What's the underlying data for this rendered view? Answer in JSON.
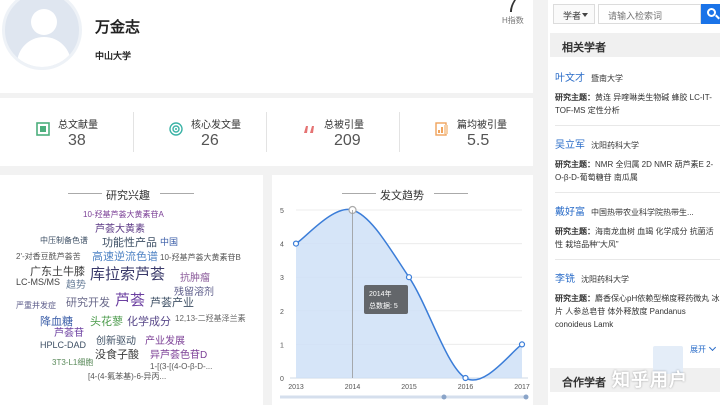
{
  "profile": {
    "name": "万金志",
    "affiliation": "中山大学",
    "hindex_value": "7",
    "hindex_label": "H指数"
  },
  "stats": [
    {
      "label": "总文献量",
      "value": "38",
      "icon": "document-icon",
      "color": "#4caf7d"
    },
    {
      "label": "核心发文量",
      "value": "26",
      "icon": "target-icon",
      "color": "#3bb3a6"
    },
    {
      "label": "总被引量",
      "value": "209",
      "icon": "quote-icon",
      "color": "#e57373"
    },
    {
      "label": "篇均被引量",
      "value": "5.5",
      "icon": "chart-doc-icon",
      "color": "#f0a35c"
    }
  ],
  "interest": {
    "title": "研究兴趣",
    "words": [
      {
        "text": "10-羟基芦荟大黄素苷A",
        "color": "#7b3f96",
        "size": 8
      },
      {
        "text": "芦荟大黄素",
        "color": "#5c3a86",
        "size": 10
      },
      {
        "text": "中压制备色谱",
        "color": "#3d4f64",
        "size": 8
      },
      {
        "text": "功能性产品",
        "color": "#3d4f64",
        "size": 11
      },
      {
        "text": "中国",
        "color": "#3b5ea8",
        "size": 9
      },
      {
        "text": "2'-对香豆酰芦荟苦",
        "color": "#555555",
        "size": 8
      },
      {
        "text": "高速逆流色谱",
        "color": "#4f83c4",
        "size": 11
      },
      {
        "text": "10-羟基芦荟大黄素苷B",
        "color": "#555555",
        "size": 8
      },
      {
        "text": "广东土牛膝",
        "color": "#3a3a3a",
        "size": 11
      },
      {
        "text": "库拉索芦荟",
        "color": "#3a3a6a",
        "size": 15
      },
      {
        "text": "抗肿瘤",
        "color": "#8a5a9a",
        "size": 10
      },
      {
        "text": "LC-MS/MS",
        "color": "#444444",
        "size": 9
      },
      {
        "text": "趋势",
        "color": "#6a7f9a",
        "size": 10
      },
      {
        "text": "残留溶剂",
        "color": "#5c5c8a",
        "size": 10
      },
      {
        "text": "严重并发症",
        "color": "#5c5c8a",
        "size": 8
      },
      {
        "text": "研究开发",
        "color": "#6a6a8a",
        "size": 11
      },
      {
        "text": "芦荟",
        "color": "#6b3fa0",
        "size": 15
      },
      {
        "text": "芦荟产业",
        "color": "#3d4f64",
        "size": 11
      },
      {
        "text": "降血糖",
        "color": "#3b5ea8",
        "size": 11
      },
      {
        "text": "头花蓼",
        "color": "#4a9a4a",
        "size": 11
      },
      {
        "text": "化学成分",
        "color": "#5a4a8a",
        "size": 11
      },
      {
        "text": "12,13-二羟基泽兰素",
        "color": "#666666",
        "size": 8
      },
      {
        "text": "芦荟苷",
        "color": "#6b3fa0",
        "size": 10
      },
      {
        "text": "HPLC-DAD",
        "color": "#3d4f64",
        "size": 9
      },
      {
        "text": "创新驱动",
        "color": "#3d4f64",
        "size": 10
      },
      {
        "text": "产业发展",
        "color": "#7b3f96",
        "size": 10
      },
      {
        "text": "没食子酸",
        "color": "#3a3a3a",
        "size": 11
      },
      {
        "text": "异芦荟色苷D",
        "color": "#7b3f96",
        "size": 10
      },
      {
        "text": "3T3-L1细胞",
        "color": "#5a8a5a",
        "size": 8
      },
      {
        "text": "1-[(3-[(4-O-β-D-...",
        "color": "#555555",
        "size": 8
      },
      {
        "text": "[4-(4-氟苯基)-6-异丙...",
        "color": "#555555",
        "size": 8
      }
    ]
  },
  "trend": {
    "title": "发文趋势",
    "tooltip": {
      "year": "2014年",
      "label": "总数据",
      "value": "5"
    }
  },
  "chart_data": {
    "type": "area",
    "title": "发文趋势",
    "x": [
      "2013",
      "2014",
      "2015",
      "2016",
      "2017"
    ],
    "values": [
      4,
      5,
      3,
      0,
      1
    ],
    "ylim": [
      0,
      5
    ],
    "yticks": [
      0,
      1,
      2,
      3,
      4,
      5
    ],
    "grid": true,
    "color": "#3b7dd8"
  },
  "search": {
    "select_label": "学者",
    "placeholder": "请输入检索词"
  },
  "related": {
    "title": "相关学者",
    "topic_label": "研究主题：",
    "scholars": [
      {
        "name": "叶文才",
        "inst": "暨南大学",
        "topics": "黄连  异喹啉类生物碱  蜂胶  LC-IT-TOF-MS  定性分析"
      },
      {
        "name": "吴立军",
        "inst": "沈阳药科大学",
        "topics": "NMR  全归属  2D NMR  葫芦素E 2-O-β-D-葡萄糖苷  南瓜属"
      },
      {
        "name": "戴好富",
        "inst": "中国热带农业科学院热带生...",
        "topics": "海南龙血树  血竭  化学成分  抗菌活性  栽培品种“大风”"
      },
      {
        "name": "李铣",
        "inst": "沈阳药科大学",
        "topics": "麝香保心pH依赖型梯度释药微丸  冰片  人参总皂苷  体外释放度  Pandanus conoideus Lamk"
      }
    ],
    "expand_label": "展开"
  },
  "coauthors": {
    "title": "合作学者"
  },
  "watermark": "知乎用户"
}
